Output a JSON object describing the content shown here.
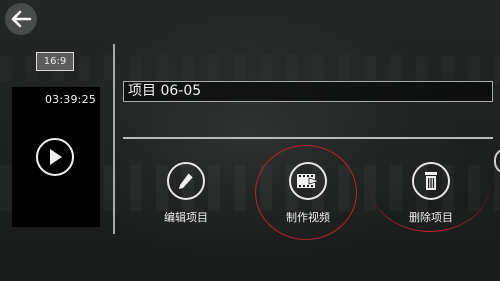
{
  "header": {
    "back_icon": "arrow-left-icon"
  },
  "preview": {
    "aspect_ratio": "16:9",
    "duration": "03:39:25",
    "play_icon": "play-icon"
  },
  "project": {
    "title": "项目 06-05"
  },
  "actions": [
    {
      "label": "编辑项目",
      "icon": "pencil-icon"
    },
    {
      "label": "制作视频",
      "icon": "film-export-icon"
    },
    {
      "label": "删除项目",
      "icon": "trash-icon"
    }
  ],
  "annotation_color": "#b8232d"
}
